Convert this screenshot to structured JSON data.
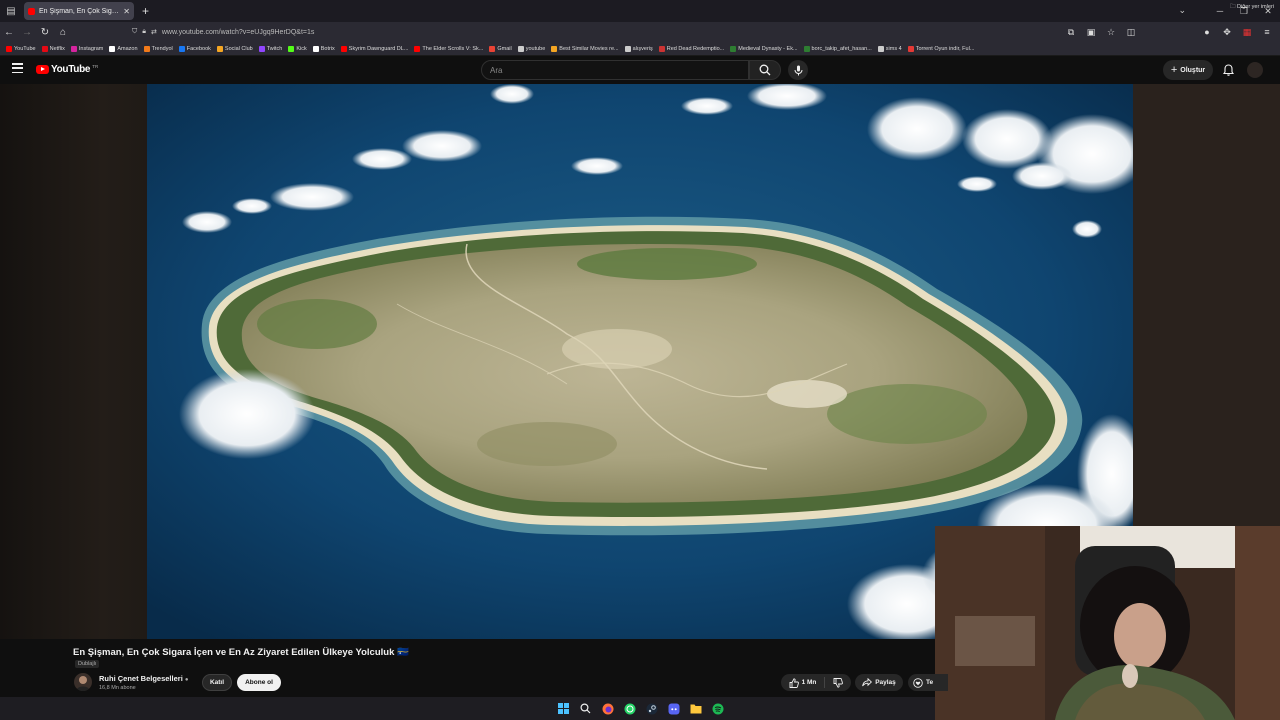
{
  "browser": {
    "tab_title": "En Şişman, En Çok Sigara İçen ve...",
    "url": "www.youtube.com/watch?v=eUJgq9HerDQ&t=1s",
    "bookmarks": [
      {
        "label": "YouTube",
        "color": "#ff0000"
      },
      {
        "label": "Netflix",
        "color": "#e50914"
      },
      {
        "label": "Instagram",
        "color": "#d6249f"
      },
      {
        "label": "Amazon",
        "color": "#ffffff"
      },
      {
        "label": "Trendyol",
        "color": "#f27a1a"
      },
      {
        "label": "Facebook",
        "color": "#1877f2"
      },
      {
        "label": "Social Club",
        "color": "#f5a623"
      },
      {
        "label": "Twitch",
        "color": "#9146ff"
      },
      {
        "label": "Kick",
        "color": "#53fc18"
      },
      {
        "label": "Botrix",
        "color": "#ffffff"
      },
      {
        "label": "Skyrim Dawnguard DL...",
        "color": "#ff0000"
      },
      {
        "label": "The Elder Scrolls V: Sk...",
        "color": "#ff0000"
      },
      {
        "label": "Gmail",
        "color": "#ea4335"
      },
      {
        "label": "youtube",
        "color": "#cccccc"
      },
      {
        "label": "Best Similar Movies re...",
        "color": "#f5a623"
      },
      {
        "label": "alışveriş",
        "color": "#cccccc"
      },
      {
        "label": "Red Dead Redemptio...",
        "color": "#cc3333"
      },
      {
        "label": "Medieval Dynasty - Ek...",
        "color": "#2e7d32"
      },
      {
        "label": "borc_takip_afet_hasan...",
        "color": "#2e7d32"
      },
      {
        "label": "sims 4",
        "color": "#cccccc"
      },
      {
        "label": "Torrent Oyun indir, Ful...",
        "color": "#e53935"
      }
    ],
    "other_bookmarks": "Diğer yer imleri"
  },
  "youtube": {
    "logo_text": "YouTube",
    "country": "TR",
    "search_placeholder": "Ara",
    "create_label": "Oluştur"
  },
  "video": {
    "title": "En Şişman, En Çok Sigara İçen ve En Az Ziyaret Edilen Ülkeye Yolculuk 🇳🇷",
    "dub_label": "Dublajlı",
    "channel_name": "Ruhi Çenet Belgeselleri",
    "subscribers": "16,8 Mn abone",
    "join_label": "Katıl",
    "subscribe_label": "Abone ol",
    "likes": "1 Mn",
    "share_label": "Paylaş",
    "thanks_label": "Te"
  },
  "colors": {
    "accent_red": "#ff0000",
    "ocean": "#0e3d63"
  }
}
